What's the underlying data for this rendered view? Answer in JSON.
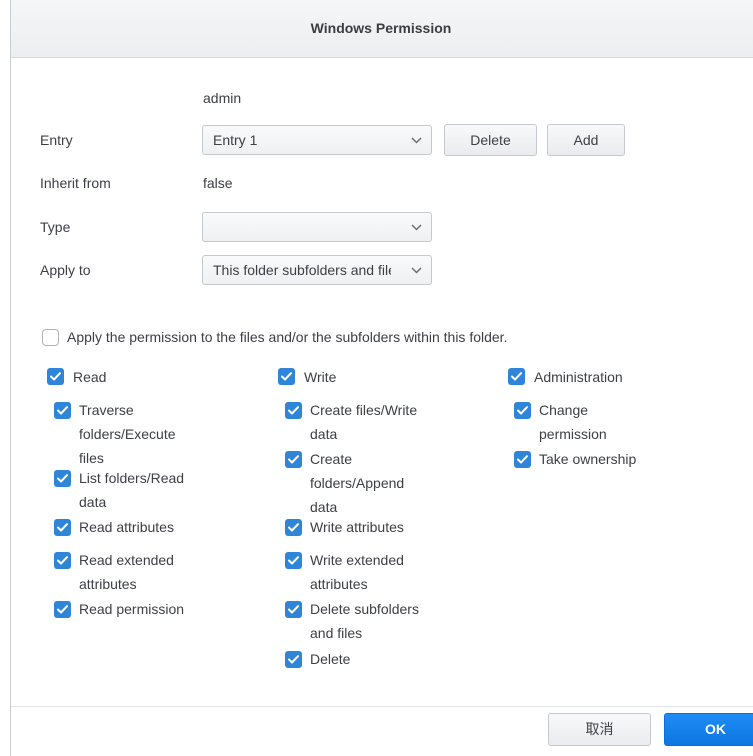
{
  "dialog": {
    "title": "Windows Permission"
  },
  "form": {
    "user": "admin",
    "entry_label": "Entry",
    "entry_value": "Entry 1",
    "delete_label": "Delete",
    "add_label": "Add",
    "inherit_label": "Inherit from",
    "inherit_value": "false",
    "type_label": "Type",
    "type_value": "",
    "apply_label": "Apply to",
    "apply_value": "This folder subfolders and files"
  },
  "apply_permission": {
    "label": "Apply the permission to the files and/or the subfolders within this folder.",
    "checked": false
  },
  "permissions": {
    "read": {
      "label": "Read",
      "items": [
        {
          "lines": [
            "Traverse",
            "folders/Execute",
            "files"
          ]
        },
        {
          "lines": [
            "List folders/Read",
            "data"
          ]
        },
        {
          "lines": [
            "Read attributes"
          ]
        },
        {
          "lines": [
            "Read extended",
            "attributes"
          ]
        },
        {
          "lines": [
            "Read permission"
          ]
        }
      ]
    },
    "write": {
      "label": "Write",
      "items": [
        {
          "lines": [
            "Create files/Write",
            "data"
          ]
        },
        {
          "lines": [
            "Create",
            "folders/Append",
            "data"
          ]
        },
        {
          "lines": [
            "Write attributes"
          ]
        },
        {
          "lines": [
            "Write extended",
            "attributes"
          ]
        },
        {
          "lines": [
            "Delete subfolders",
            "and files"
          ]
        },
        {
          "lines": [
            "Delete"
          ]
        }
      ]
    },
    "administration": {
      "label": "Administration",
      "items": [
        {
          "lines": [
            "Change",
            "permission"
          ]
        },
        {
          "lines": [
            "Take ownership"
          ]
        }
      ]
    }
  },
  "footer": {
    "cancel_label": "取消",
    "ok_label": "OK"
  },
  "icons": {
    "chevron": "chevron-down-icon",
    "check": "checkmark-icon"
  },
  "colors": {
    "accent": "#2f86d9",
    "primary_button": "#1581ec"
  }
}
